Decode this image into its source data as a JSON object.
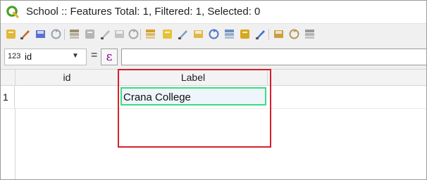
{
  "window": {
    "title": "School :: Features Total: 1, Filtered: 1, Selected: 0",
    "logo_icon": "qgis-logo-icon"
  },
  "toolbar": {
    "buttons": [
      {
        "icon": "toggle-editing-icon",
        "color": "#e2b63a"
      },
      {
        "icon": "multi-edit-icon",
        "color": "#c7612a"
      },
      {
        "icon": "save-edits-icon",
        "color": "#5b6fd0"
      },
      {
        "icon": "reload-icon",
        "color": "#9aa3b0"
      },
      {
        "icon": "add-feature-icon",
        "color": "#9a8f70"
      },
      {
        "icon": "delete-feature-icon",
        "color": "#b5b5b5"
      },
      {
        "icon": "cut-icon",
        "color": "#b8b8b8"
      },
      {
        "icon": "copy-icon",
        "color": "#c2c2c2"
      },
      {
        "icon": "paste-icon",
        "color": "#a8a8a8"
      },
      {
        "icon": "select-by-expression-icon",
        "color": "#d3a02a"
      },
      {
        "icon": "select-all-icon",
        "color": "#e6c23a"
      },
      {
        "icon": "invert-selection-icon",
        "color": "#7aa0c8"
      },
      {
        "icon": "deselect-all-icon",
        "color": "#e0b84a"
      },
      {
        "icon": "filter-icon",
        "color": "#5577c8"
      },
      {
        "icon": "move-selection-to-top-icon",
        "color": "#6a8fc0"
      },
      {
        "icon": "pan-to-selection-icon",
        "color": "#d6a81f"
      },
      {
        "icon": "zoom-to-selection-icon",
        "color": "#3b6fd6"
      },
      {
        "icon": "new-field-icon",
        "color": "#c9a041"
      },
      {
        "icon": "delete-field-icon",
        "color": "#b89a5c"
      },
      {
        "icon": "field-calculator-icon",
        "color": "#9a9a9a"
      }
    ]
  },
  "expression_bar": {
    "field_type": "123",
    "field_name": "id",
    "equals": "=",
    "epsilon": "ε",
    "expression_value": ""
  },
  "table": {
    "headers": [
      "id",
      "Label"
    ],
    "rows": [
      {
        "row_number": "1",
        "id": "",
        "label": "Crana College"
      }
    ]
  },
  "annotation": {
    "highlight_color": "#d61f2c",
    "edit_cell_color": "#3ddc84"
  }
}
